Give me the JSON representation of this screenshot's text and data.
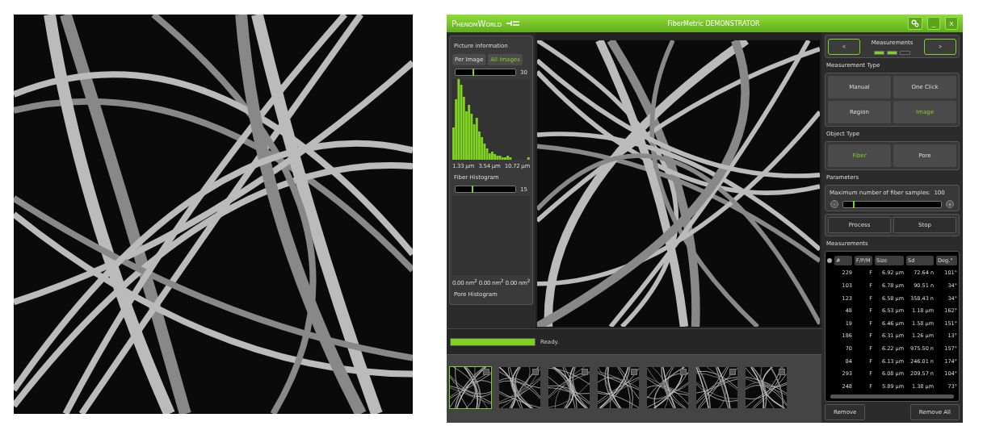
{
  "window": {
    "logo": "PhenomWorld",
    "title": "FiberMetric DEMONSTRATOR",
    "controls": [
      "_",
      "X"
    ]
  },
  "picture_info": {
    "title": "Picture information",
    "tabs": [
      {
        "label": "Per Image",
        "selected": false
      },
      {
        "label": "All Images",
        "selected": true
      }
    ],
    "fiber_histogram": {
      "level": 0.28,
      "bin_count": "30",
      "axis_labels": [
        "1.33 µm",
        "3.54 µm",
        "10.72 µm"
      ],
      "title": "Fiber Histogram"
    },
    "pore_histogram": {
      "level": 0.27,
      "bin_count": "15",
      "axis_labels": [
        "0.00 nm$^{2}$",
        "0.00 nm$^{2}$",
        "0.00 nm$^{2}$"
      ],
      "title": "Pore Histogram"
    }
  },
  "status": {
    "level": 1,
    "text": "Ready."
  },
  "thumbnails": [
    {
      "selected": true
    },
    {
      "selected": false
    },
    {
      "selected": false
    },
    {
      "selected": false
    },
    {
      "selected": false
    },
    {
      "selected": false
    },
    {
      "selected": false
    }
  ],
  "navigation": {
    "prev": "<",
    "next": ">",
    "title": "Measurements",
    "steps": [
      {
        "filled": true
      },
      {
        "filled": true
      },
      {
        "filled": false
      }
    ]
  },
  "measurement_type": {
    "label": "Measurement Type",
    "options": [
      {
        "label": "Manual",
        "selected": false
      },
      {
        "label": "One Click",
        "selected": false
      },
      {
        "label": "Region",
        "selected": false
      },
      {
        "label": "Image",
        "selected": true
      }
    ]
  },
  "object_type": {
    "label": "Object Type",
    "options": [
      {
        "label": "Fiber",
        "selected": true
      },
      {
        "label": "Pore",
        "selected": false
      }
    ]
  },
  "parameters": {
    "label": "Parameters",
    "slider_label": "Maximum number of fiber samples:  100",
    "minus": "-",
    "plus": "+",
    "level": 0.1
  },
  "actions": [
    "Process",
    "Stop"
  ],
  "measurements": {
    "label": "Measurements",
    "columns": [
      "#",
      "F/P/M",
      "Size",
      "Sd",
      "Deg.°"
    ],
    "rows": [
      [
        "229",
        "F",
        "6.92 µm",
        "72.64 n",
        "101°"
      ],
      [
        "103",
        "F",
        "6.78 µm",
        "90.51 n",
        "34°"
      ],
      [
        "123",
        "F",
        "6.58 µm",
        "358.43 n",
        "34°"
      ],
      [
        "48",
        "F",
        "6.53 µm",
        "1.18 µm",
        "162°"
      ],
      [
        "19",
        "F",
        "6.46 µm",
        "1.58 µm",
        "151°"
      ],
      [
        "186",
        "F",
        "6.31 µm",
        "1.26 µm",
        "13°"
      ],
      [
        "70",
        "F",
        "6.22 µm",
        "975.50 n",
        "157°"
      ],
      [
        "84",
        "F",
        "6.13 µm",
        "246.01 n",
        "174°"
      ],
      [
        "293",
        "F",
        "6.08 µm",
        "209.57 n",
        "104°"
      ],
      [
        "248",
        "F",
        "5.89 µm",
        "1.38 µm",
        "73°"
      ]
    ],
    "buttons": [
      "Remove",
      "Remove All"
    ]
  }
}
